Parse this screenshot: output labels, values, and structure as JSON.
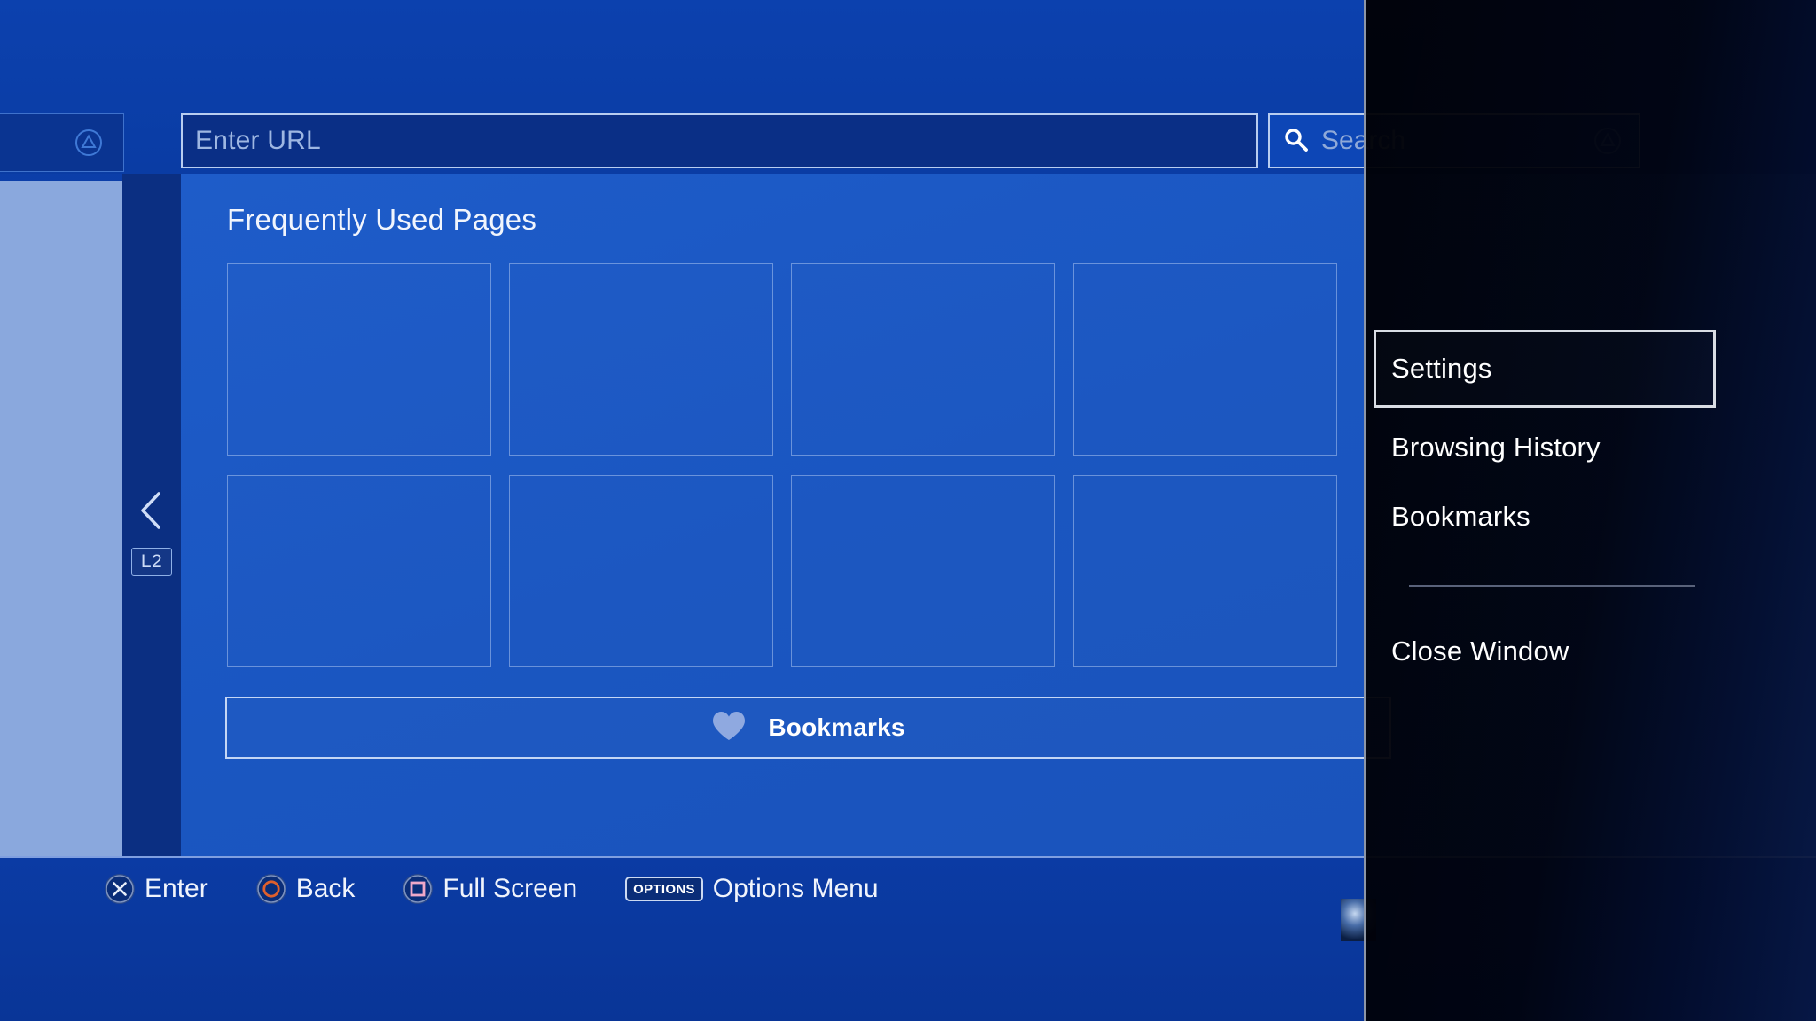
{
  "browser": {
    "url_bar": {
      "placeholder": "Enter URL",
      "value": "",
      "button_icon": "triangle-button-icon"
    },
    "search_bar": {
      "placeholder": "Search",
      "value": "",
      "search_icon": "search-icon",
      "button_icon": "triangle-button-icon"
    },
    "left_tab": {
      "button_icon": "triangle-button-icon"
    },
    "left_nav": {
      "chevron_icon": "chevron-left-icon",
      "shoulder_button": "L2"
    },
    "page_title": "Frequently Used Pages",
    "tiles": [
      {
        "index": 1,
        "label": ""
      },
      {
        "index": 2,
        "label": ""
      },
      {
        "index": 3,
        "label": ""
      },
      {
        "index": 4,
        "label": ""
      },
      {
        "index": 5,
        "label": ""
      },
      {
        "index": 6,
        "label": ""
      },
      {
        "index": 7,
        "label": ""
      },
      {
        "index": 8,
        "label": ""
      }
    ],
    "bookmarks_bar": {
      "label": "Bookmarks",
      "icon": "heart-icon"
    }
  },
  "footer": {
    "hints": [
      {
        "icon": "cross-button-icon",
        "glyph": "✕",
        "label": "Enter"
      },
      {
        "icon": "circle-button-icon",
        "glyph": "○",
        "label": "Back"
      },
      {
        "icon": "square-button-icon",
        "glyph": "□",
        "label": "Full Screen"
      },
      {
        "icon": "options-button-icon",
        "glyph": "OPTIONS",
        "label": "Options Menu"
      }
    ]
  },
  "options_menu": {
    "items": [
      {
        "label": "Settings",
        "selected": true
      },
      {
        "label": "Browsing History",
        "selected": false
      },
      {
        "label": "Bookmarks",
        "selected": false
      },
      {
        "label": "Close Window",
        "selected": false
      }
    ]
  },
  "colors": {
    "brand_blue": "#0b3ba4",
    "content_blue": "#1a56c1",
    "accent_light": "#b8cdf0",
    "heart_blue": "#8fa9e0",
    "overlay_black": "#000204",
    "selection_border": "#d9dde4",
    "circle_button": "#e05a2b",
    "square_button": "#f0a8c8"
  }
}
